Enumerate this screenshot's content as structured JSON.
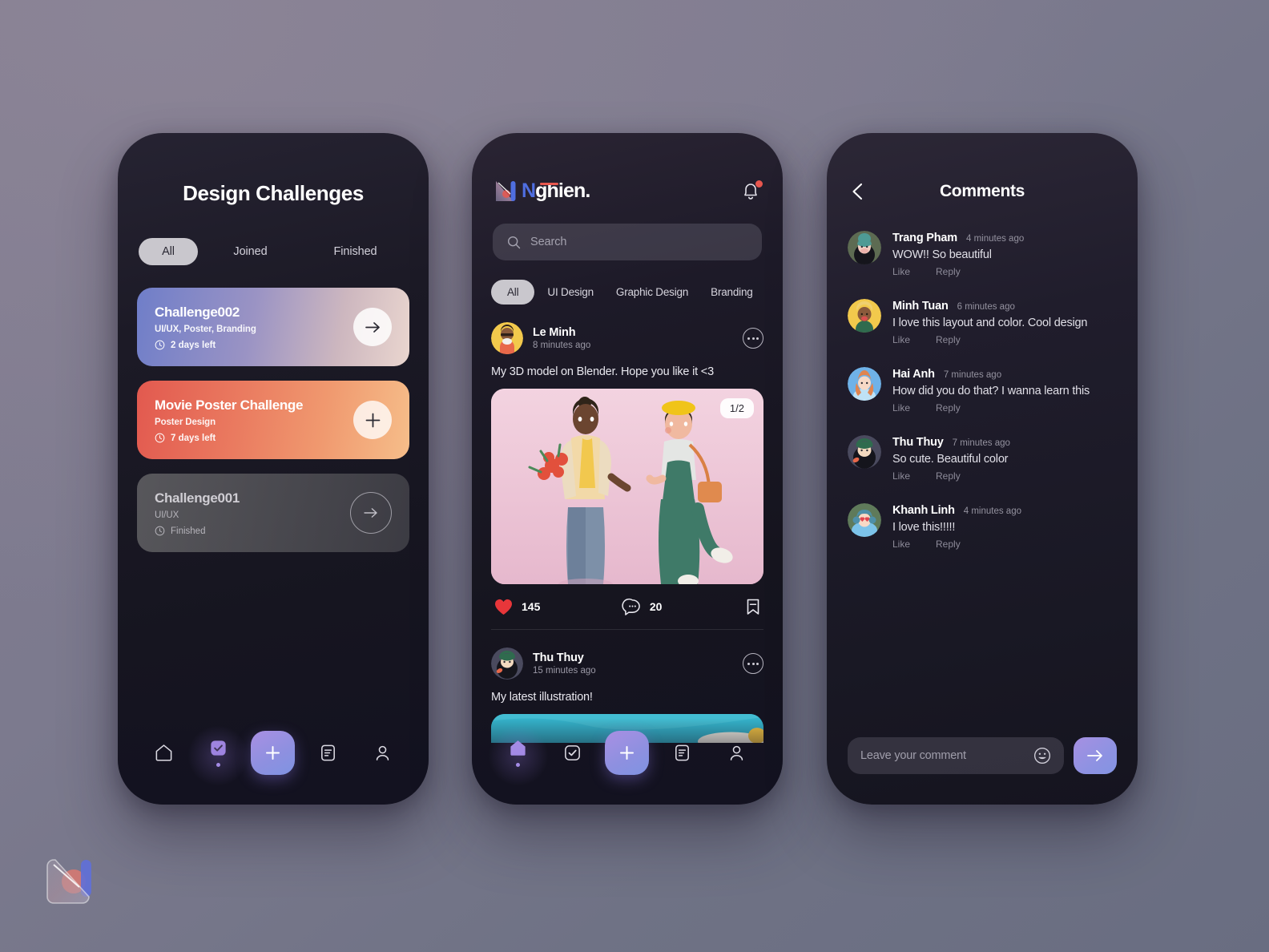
{
  "background": {
    "top_left": "#827c91",
    "bottom_right": "#696d81"
  },
  "accent": {
    "purple": "#8f90e0",
    "red": "#e8564e",
    "blue": "#4f6ee0",
    "card_orange": "#ea7b60",
    "chip_active_bg": "#c9c7cd"
  },
  "challenges_screen": {
    "title": "Design Challenges",
    "tabs": [
      {
        "label": "All",
        "active": true
      },
      {
        "label": "Joined",
        "active": false
      },
      {
        "label": "Finished",
        "active": false
      }
    ],
    "cards": [
      {
        "name": "Challenge002",
        "tags": "UI/UX, Poster, Branding",
        "meta": "2 days left",
        "action": "arrow"
      },
      {
        "name": "Movie Poster Challenge",
        "tags": "Poster Design",
        "meta": "7 days left",
        "action": "plus"
      },
      {
        "name": "Challenge001",
        "tags": "UI/UX",
        "meta": "Finished",
        "action": "arrow"
      }
    ],
    "nav": [
      {
        "icon": "home-icon",
        "active": false
      },
      {
        "icon": "tasks-check-icon",
        "active": true
      },
      {
        "icon": "plus-icon",
        "active": false
      },
      {
        "icon": "feed-document-icon",
        "active": false
      },
      {
        "icon": "profile-icon",
        "active": false
      }
    ]
  },
  "feed_screen": {
    "logo": {
      "n": "N",
      "rest": "ghien."
    },
    "notification_badge": true,
    "search": {
      "placeholder": "Search",
      "value": ""
    },
    "chips": [
      {
        "label": "All",
        "active": true
      },
      {
        "label": "UI Design",
        "active": false
      },
      {
        "label": "Graphic Design",
        "active": false
      },
      {
        "label": "Branding",
        "active": false
      }
    ],
    "posts": [
      {
        "user": "Le Minh",
        "time": "8 minutes ago",
        "caption": "My 3D model on Blender. Hope you like it <3",
        "pager": "1/2",
        "likes": "145",
        "comments": "20"
      },
      {
        "user": "Thu Thuy",
        "time": "15 minutes ago",
        "caption": "My latest illustration!"
      }
    ],
    "nav": [
      {
        "icon": "home-icon",
        "active": true
      },
      {
        "icon": "tasks-check-icon",
        "active": false
      },
      {
        "icon": "plus-icon",
        "active": false
      },
      {
        "icon": "feed-document-icon",
        "active": false
      },
      {
        "icon": "profile-icon",
        "active": false
      }
    ]
  },
  "comments_screen": {
    "title": "Comments",
    "comments": [
      {
        "name": "Trang Pham",
        "time": "4 minutes ago",
        "text": "WOW!! So beautiful",
        "like": "Like",
        "reply": "Reply"
      },
      {
        "name": "Minh Tuan",
        "time": "6 minutes ago",
        "text": "I love this layout and color. Cool design",
        "like": "Like",
        "reply": "Reply"
      },
      {
        "name": "Hai Anh",
        "time": "7 minutes ago",
        "text": "How did you do that? I wanna learn this",
        "like": "Like",
        "reply": "Reply"
      },
      {
        "name": "Thu Thuy",
        "time": "7 minutes ago",
        "text": "So cute. Beautiful color",
        "like": "Like",
        "reply": "Reply"
      },
      {
        "name": "Khanh Linh",
        "time": "4 minutes ago",
        "text": "I love this!!!!!",
        "like": "Like",
        "reply": "Reply"
      }
    ],
    "input": {
      "placeholder": "Leave your comment",
      "value": ""
    }
  }
}
